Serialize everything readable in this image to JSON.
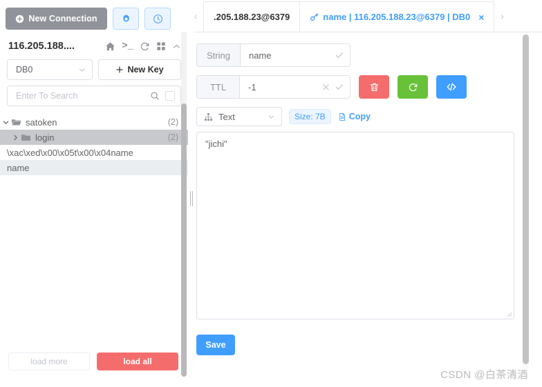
{
  "colors": {
    "accent": "#409eff",
    "danger": "#f56c6c",
    "success": "#67c23a",
    "neutral": "#909399",
    "border": "#dcdfe6",
    "selected_row": "#c8c9cc"
  },
  "sidebar": {
    "new_connection_label": "New Connection",
    "settings_button_title": "Settings",
    "history_button_title": "History",
    "connection_name": "116.205.188....",
    "header_icons": [
      {
        "name": "home-icon",
        "title": "Home"
      },
      {
        "name": "terminal-icon",
        "title": "Console",
        "glyph": ">_"
      },
      {
        "name": "refresh-icon",
        "title": "Refresh"
      },
      {
        "name": "grid-icon",
        "title": "Grid"
      },
      {
        "name": "chevron-up-icon",
        "title": "Collapse"
      }
    ],
    "db_select_value": "DB0",
    "new_key_label": "New Key",
    "search_placeholder": "Enter To Search",
    "search_value": "",
    "tree": [
      {
        "type": "folder",
        "label": "satoken",
        "count": "(2)",
        "expanded": true,
        "depth": 0,
        "selected": false
      },
      {
        "type": "folder",
        "label": "login",
        "count": "(2)",
        "expanded": false,
        "depth": 1,
        "selected": true
      },
      {
        "type": "key",
        "label": "\\xac\\xed\\x00\\x05t\\x00\\x04name",
        "depth": 0,
        "selected": false
      },
      {
        "type": "key",
        "label": "name",
        "depth": 0,
        "selected": true
      }
    ],
    "load_more_label": "load more",
    "load_all_label": "load all"
  },
  "tabs": {
    "prev_arrow": "‹",
    "next_arrow": "›",
    "items": [
      {
        "label": ".205.188.23@6379",
        "active": false,
        "closable": false,
        "icon": ""
      },
      {
        "label": "name | 116.205.188.23@6379 | DB0",
        "active": true,
        "closable": true,
        "icon": "key-icon",
        "close_glyph": "×"
      }
    ]
  },
  "editor": {
    "key_type_label": "String",
    "key_name_value": "name",
    "key_name_confirm_icon": "check-icon",
    "ttl_label": "TTL",
    "ttl_value": "-1",
    "ttl_clear_icon": "close-icon",
    "ttl_confirm_icon": "check-icon",
    "actions": [
      {
        "name": "delete-key-button",
        "icon": "trash-icon",
        "color": "#f56c6c",
        "title": "Delete"
      },
      {
        "name": "refresh-value-button",
        "icon": "refresh-icon",
        "color": "#67c23a",
        "title": "Refresh"
      },
      {
        "name": "format-view-button",
        "icon": "code-icon",
        "color": "#409eff",
        "title": "View as code"
      }
    ],
    "view_format": "Text",
    "size_badge": "Size: 7B",
    "copy_label": "Copy",
    "value_text": "\"jichi\"",
    "save_label": "Save"
  },
  "watermark": "CSDN @白茶清酒"
}
